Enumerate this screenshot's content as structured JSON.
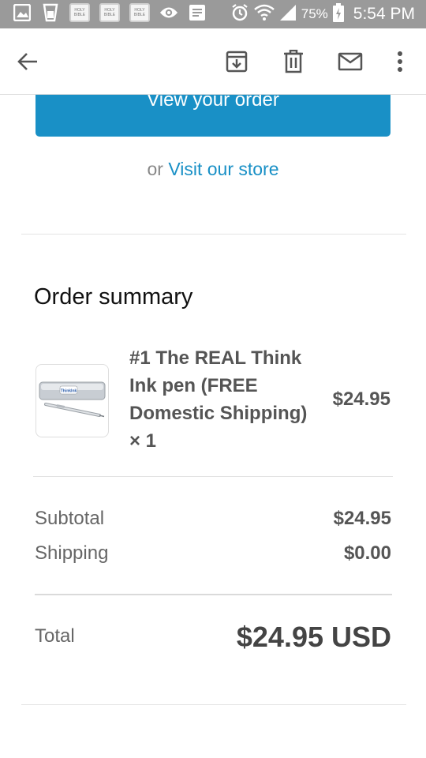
{
  "status_bar": {
    "bible_label": "HOLY BIBLE",
    "battery_percent": "75%",
    "time": "5:54 PM",
    "icons": [
      "gallery-icon",
      "cup-icon",
      "bible-icon",
      "bible-icon",
      "bible-icon",
      "eye-icon",
      "notes-icon",
      "alarm-icon",
      "wifi-icon",
      "signal-icon",
      "battery-charging-icon"
    ]
  },
  "app_bar": {
    "icons": [
      "back-arrow-icon",
      "archive-icon",
      "delete-icon",
      "mail-icon",
      "more-vert-icon"
    ]
  },
  "email": {
    "view_order_button": "View your order",
    "store_prefix": "or ",
    "store_link": "Visit our store",
    "summary_title": "Order summary",
    "item": {
      "name": "#1 The REAL Think Ink pen (FREE Domestic Shipping) × 1",
      "price": "$24.95",
      "box_label": "ThinkInk"
    },
    "subtotal_label": "Subtotal",
    "subtotal_value": "$24.95",
    "shipping_label": "Shipping",
    "shipping_value": "$0.00",
    "total_label": "Total",
    "total_value": "$24.95 USD"
  },
  "colors": {
    "accent": "#1990c6",
    "status_bar": "#9a9a9a"
  }
}
